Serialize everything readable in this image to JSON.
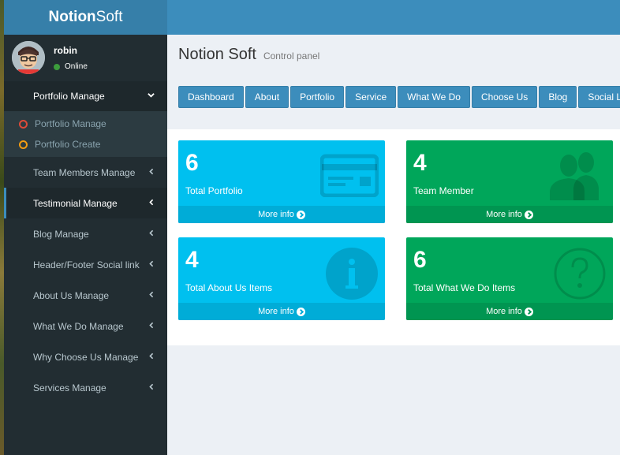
{
  "brand": {
    "name_bold": "Notion",
    "name_rest": "Soft"
  },
  "user": {
    "name": "robin",
    "status": "Online"
  },
  "sidebar": {
    "items": [
      {
        "label": "Portfolio Manage"
      },
      {
        "label": "Team Members Manage"
      },
      {
        "label": "Testimonial Manage"
      },
      {
        "label": "Blog Manage"
      },
      {
        "label": "Header/Footer Social link"
      },
      {
        "label": "About Us Manage"
      },
      {
        "label": "What We Do Manage"
      },
      {
        "label": "Why Choose Us Manage"
      },
      {
        "label": "Services Manage"
      }
    ],
    "submenu": [
      {
        "label": "Portfolio Manage",
        "color": "#dd4b39"
      },
      {
        "label": "Portfolio Create",
        "color": "#f39c12"
      }
    ]
  },
  "header": {
    "title": "Notion Soft",
    "subtitle": "Control panel"
  },
  "nav_buttons": [
    "Dashboard",
    "About",
    "Portfolio",
    "Service",
    "What We Do",
    "Choose Us",
    "Blog",
    "Social Link"
  ],
  "boxes": [
    {
      "count": "6",
      "label": "Total Portfolio",
      "more": "More info",
      "icon": "credit-card-icon"
    },
    {
      "count": "4",
      "label": "Team Member",
      "more": "More info",
      "icon": "users-icon"
    },
    {
      "count": "4",
      "label": "Total About Us Items",
      "more": "More info",
      "icon": "info-icon"
    },
    {
      "count": "6",
      "label": "Total What We Do Items",
      "more": "More info",
      "icon": "question-icon"
    }
  ],
  "colors": {
    "aqua": "#00c0ef",
    "green": "#00a65a",
    "header": "#3c8dbc",
    "sidebar": "#222d32"
  }
}
